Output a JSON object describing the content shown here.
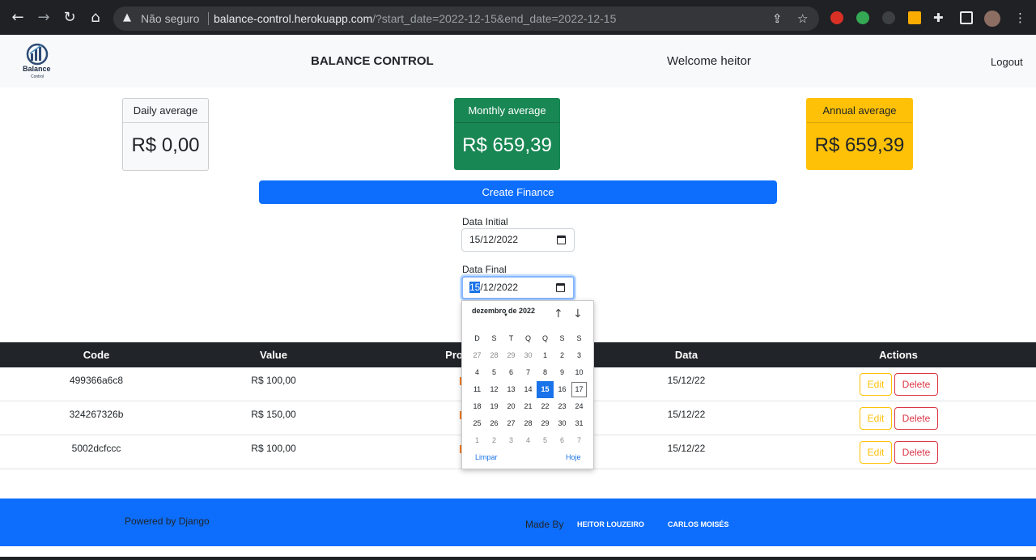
{
  "browser": {
    "security_label": "Não seguro",
    "url_host": "balance-control.herokuapp.com",
    "url_path": "/?start_date=2022-12-15&end_date=2022-12-15"
  },
  "header": {
    "logo_text": "Balance",
    "logo_subtext": "Control",
    "title": "BALANCE CONTROL",
    "welcome": "Welcome heitor",
    "logout": "Logout"
  },
  "cards": {
    "daily": {
      "label": "Daily average",
      "value": "R$ 0,00"
    },
    "monthly": {
      "label": "Monthly average",
      "value": "R$ 659,39"
    },
    "annual": {
      "label": "Annual average",
      "value": "R$ 659,39"
    }
  },
  "create_button": "Create Finance",
  "filters": {
    "initial_label": "Data Initial",
    "initial_value": "15/12/2022",
    "final_label": "Data Final",
    "final_value_day": "15",
    "final_value_rest": "/12/2022"
  },
  "table": {
    "headers": {
      "code": "Code",
      "value": "Value",
      "product": "Pro",
      "date": "Data",
      "actions": "Actions"
    },
    "rows": [
      {
        "code": "499366a6c8",
        "value": "R$ 100,00",
        "date": "15/12/22"
      },
      {
        "code": "324267326b",
        "value": "R$ 150,00",
        "date": "15/12/22"
      },
      {
        "code": "5002dcfccc",
        "value": "R$ 100,00",
        "date": "15/12/22"
      }
    ],
    "edit_label": "Edit",
    "delete_label": "Delete"
  },
  "datepicker": {
    "month_label": "dezembro de 2022",
    "weekdays": [
      "D",
      "S",
      "T",
      "Q",
      "Q",
      "S",
      "S"
    ],
    "weeks": [
      [
        "27",
        "28",
        "29",
        "30",
        "1",
        "2",
        "3"
      ],
      [
        "4",
        "5",
        "6",
        "7",
        "8",
        "9",
        "10"
      ],
      [
        "11",
        "12",
        "13",
        "14",
        "15",
        "16",
        "17"
      ],
      [
        "18",
        "19",
        "20",
        "21",
        "22",
        "23",
        "24"
      ],
      [
        "25",
        "26",
        "27",
        "28",
        "29",
        "30",
        "31"
      ],
      [
        "1",
        "2",
        "3",
        "4",
        "5",
        "6",
        "7"
      ]
    ],
    "selected_day": "15",
    "today_day": "17",
    "clear_label": "Limpar",
    "today_label": "Hoje"
  },
  "footer": {
    "powered": "Powered by Django",
    "made_by": "Made By",
    "author1": "HEITOR LOUZEIRO",
    "author2": "CARLOS MOISÉS"
  },
  "colors": {
    "primary": "#0d6efd",
    "success": "#198754",
    "warning": "#ffc107",
    "danger": "#dc3545",
    "dark": "#212529"
  },
  "icons": [
    "back-arrow-icon",
    "forward-arrow-icon",
    "reload-icon",
    "home-icon",
    "warning-icon",
    "share-icon",
    "star-icon",
    "extension-icon",
    "calendar-icon",
    "arrow-up-icon",
    "arrow-down-icon"
  ]
}
